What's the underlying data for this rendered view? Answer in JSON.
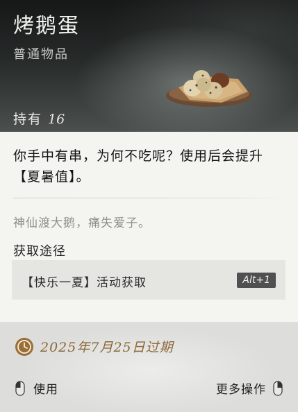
{
  "item": {
    "name": "烤鹅蛋",
    "quality": "普通物品",
    "hold_label": "持有",
    "hold_count": "16",
    "image_icon": "roast-eggs-plate-icon"
  },
  "details": {
    "description": "你手中有串，为何不吃呢？使用后会提升【夏暑值】。",
    "flavor": "神仙渡大鹅，痛失爱子。",
    "acquire_title": "获取途径",
    "acquire_source": "【快乐一夏】活动获取",
    "acquire_hotkey": "Alt+1"
  },
  "footer": {
    "expiry": "2025年7月25日过期",
    "expiry_icon": "clock-icon",
    "left_action": "使用",
    "right_action": "更多操作",
    "left_mouse_icon": "mouse-left-click-icon",
    "right_mouse_icon": "mouse-right-click-icon"
  },
  "colors": {
    "accent_gold": "#8c6738",
    "panel_bg": "#f4f4f1",
    "header_dark": "#1b1d1d"
  }
}
